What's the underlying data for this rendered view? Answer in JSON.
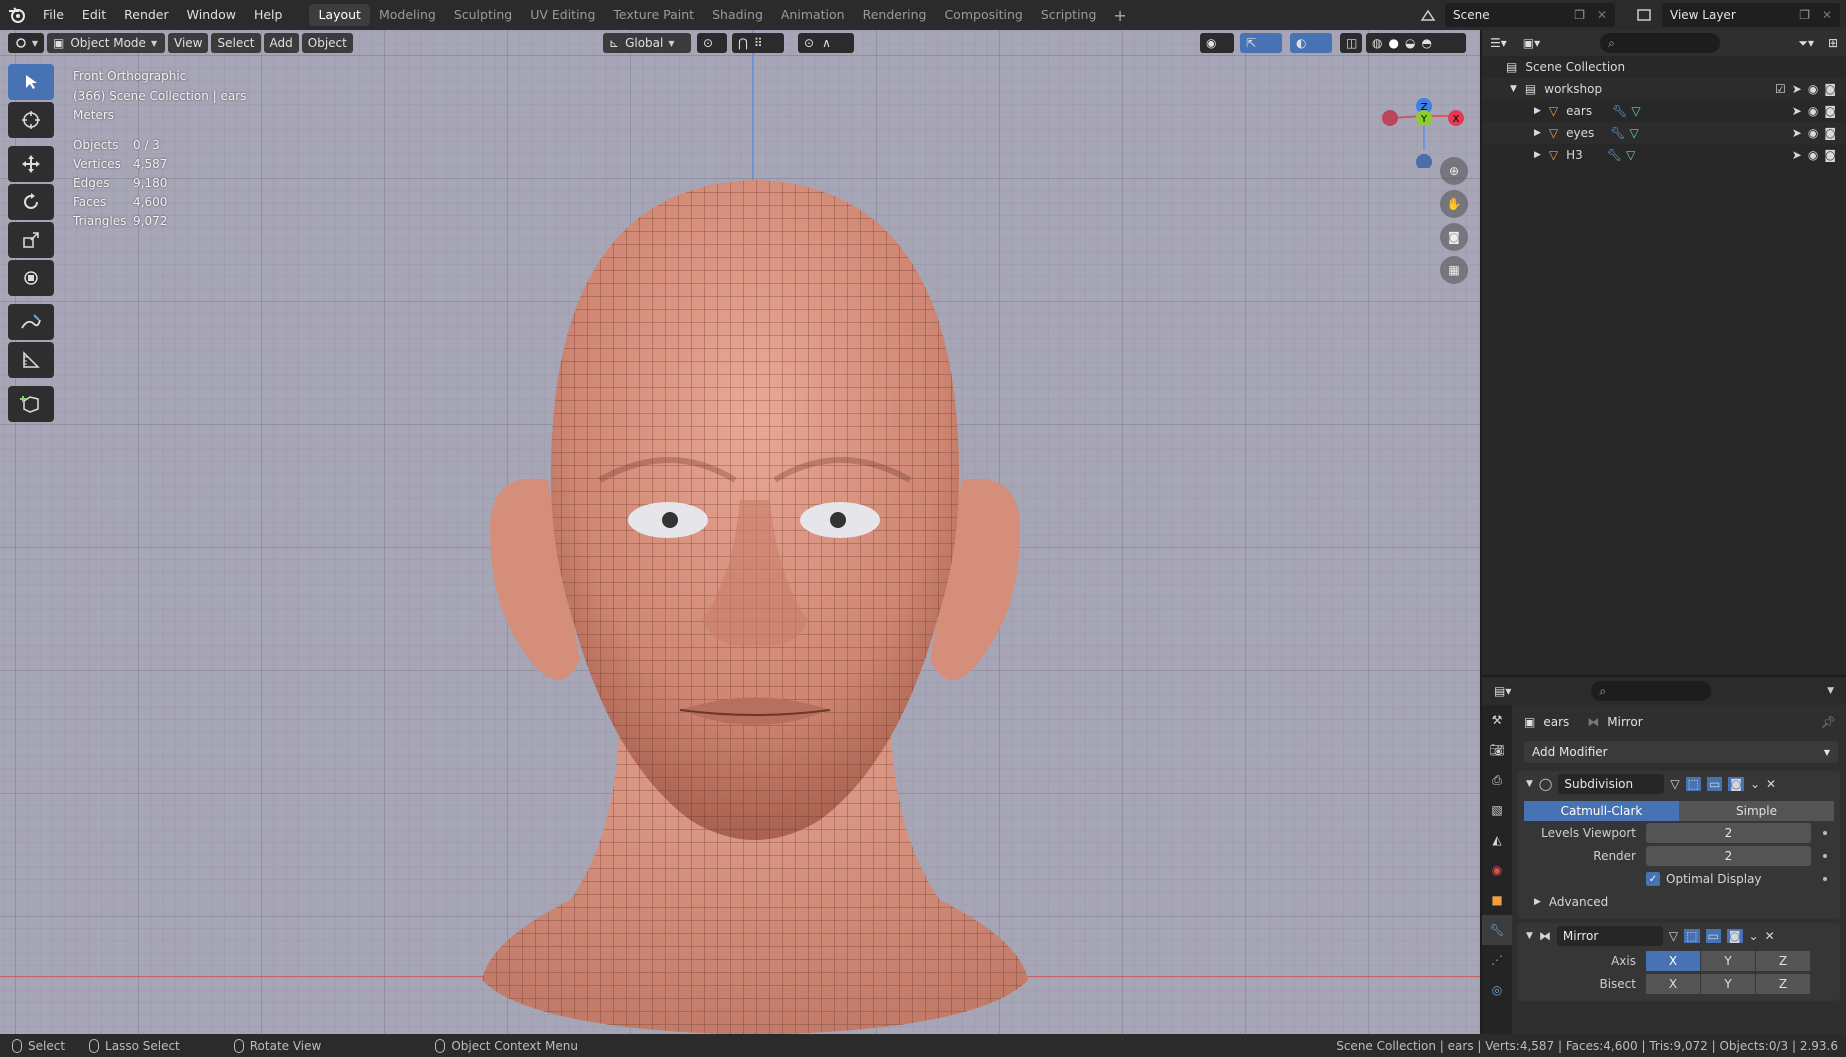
{
  "menu": {
    "items": [
      "File",
      "Edit",
      "Render",
      "Window",
      "Help"
    ]
  },
  "workspaces": {
    "tabs": [
      "Layout",
      "Modeling",
      "Sculpting",
      "UV Editing",
      "Texture Paint",
      "Shading",
      "Animation",
      "Rendering",
      "Compositing",
      "Scripting"
    ],
    "active": "Layout"
  },
  "scene": {
    "name": "Scene"
  },
  "view_layer": {
    "name": "View Layer"
  },
  "viewport": {
    "mode": "Object Mode",
    "menus": [
      "View",
      "Select",
      "Add",
      "Object"
    ],
    "transform_orientation": "Global",
    "view_name": "Front Orthographic",
    "collection_info": "(366) Scene Collection | ears",
    "units": "Meters",
    "stats": [
      {
        "label": "Objects",
        "value": "0 / 3"
      },
      {
        "label": "Vertices",
        "value": "4,587"
      },
      {
        "label": "Edges",
        "value": "9,180"
      },
      {
        "label": "Faces",
        "value": "4,600"
      },
      {
        "label": "Triangles",
        "value": "9,072"
      }
    ],
    "gizmo": {
      "z": "Z",
      "y": "Y",
      "x": "X"
    }
  },
  "outliner": {
    "root": "Scene Collection",
    "collection": "workshop",
    "objects": [
      "ears",
      "eyes",
      "H3"
    ]
  },
  "properties": {
    "object": "ears",
    "active_modifier": "Mirror",
    "add_modifier": "Add Modifier",
    "subdivision": {
      "name": "Subdivision",
      "type_catmull": "Catmull-Clark",
      "type_simple": "Simple",
      "levels_viewport_label": "Levels Viewport",
      "levels_viewport": "2",
      "render_label": "Render",
      "render": "2",
      "optimal_display": "Optimal Display",
      "advanced": "Advanced"
    },
    "mirror": {
      "name": "Mirror",
      "axis_label": "Axis",
      "bisect_label": "Bisect",
      "x": "X",
      "y": "Y",
      "z": "Z"
    }
  },
  "statusbar": {
    "select": "Select",
    "lasso": "Lasso Select",
    "rotate": "Rotate View",
    "context": "Object Context Menu",
    "info": "Scene Collection | ears | Verts:4,587 | Faces:4,600 | Tris:9,072 | Objects:0/3 | 2.93.6"
  }
}
